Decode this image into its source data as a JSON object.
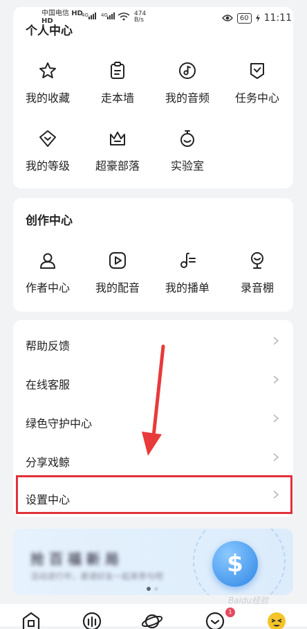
{
  "status_bar": {
    "carrier_1": "中国电信",
    "carrier_1_tag": "HD",
    "carrier_2_tag": "HD",
    "net_1": "4G",
    "net_2": "4G",
    "speed": "474",
    "speed_unit": "B/s",
    "battery": "60",
    "time": "11:11"
  },
  "personal_center": {
    "title": "个人中心",
    "items": [
      {
        "label": "我的收藏",
        "icon": "star-icon"
      },
      {
        "label": "走本墙",
        "icon": "clipboard-icon"
      },
      {
        "label": "我的音频",
        "icon": "music-note-icon"
      },
      {
        "label": "任务中心",
        "icon": "task-check-icon"
      },
      {
        "label": "我的等级",
        "icon": "level-diamond-icon"
      },
      {
        "label": "超豪部落",
        "icon": "crown-icon"
      },
      {
        "label": "实验室",
        "icon": "flask-icon"
      }
    ]
  },
  "creation_center": {
    "title": "创作中心",
    "items": [
      {
        "label": "作者中心",
        "icon": "user-icon"
      },
      {
        "label": "我的配音",
        "icon": "play-icon"
      },
      {
        "label": "我的播单",
        "icon": "playlist-icon"
      },
      {
        "label": "录音棚",
        "icon": "microphone-icon"
      }
    ]
  },
  "settings_list": {
    "items": [
      {
        "label": "帮助反馈"
      },
      {
        "label": "在线客服"
      },
      {
        "label": "绿色守护中心"
      },
      {
        "label": "分享戏鲸"
      },
      {
        "label": "设置中心"
      }
    ]
  },
  "banner": {
    "title": "抢 百 福 新 局",
    "subtitle": "活动进行中，邀请好友一起来参与吧",
    "coin_symbol": "$"
  },
  "watermark": "Baidu经验",
  "tab_badge": "1",
  "colors": {
    "highlight": "#e0313a",
    "accent_blue": "#2d86e6"
  }
}
